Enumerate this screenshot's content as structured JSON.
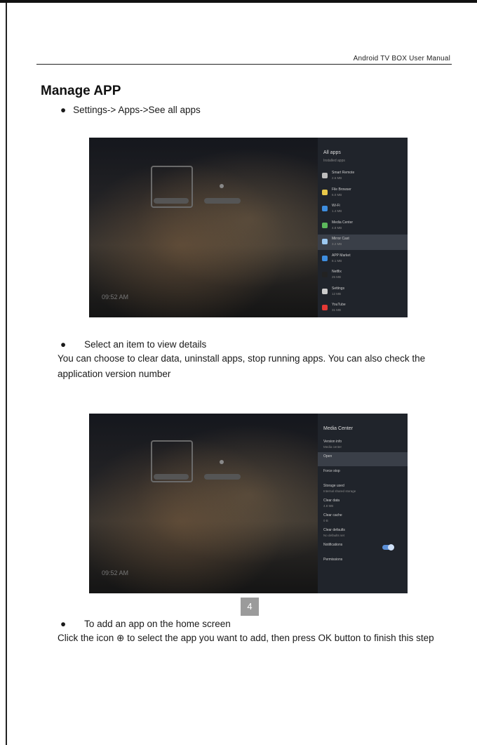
{
  "header": {
    "manual_title": "Android  TV  BOX  User  Manual"
  },
  "section": {
    "title": "Manage APP"
  },
  "step1": {
    "bullet": "●",
    "text": "Settings-> Apps->See all apps"
  },
  "screenshot1": {
    "panel_title": "All apps",
    "panel_subtitle": "Installed apps",
    "clock": "09:52 AM",
    "apps": [
      {
        "name": "Smart Remote",
        "size": "2.6 MB",
        "color": "#bdbdbd"
      },
      {
        "name": "File Browser",
        "size": "6.0 MB",
        "color": "#e8c84a"
      },
      {
        "name": "Wi-Fi",
        "size": "1.4 MB",
        "color": "#3e8ee0"
      },
      {
        "name": "Media Center",
        "size": "4.8 MB",
        "color": "#5cb85c"
      },
      {
        "name": "Mirror Cast",
        "size": "3.2 MB",
        "color": "#9cc8f0"
      },
      {
        "name": "APP Market",
        "size": "8.1 MB",
        "color": "#3e8ee0"
      },
      {
        "name": "Netflix",
        "size": "25 MB",
        "color": "#222222"
      },
      {
        "name": "Settings",
        "size": "12 MB",
        "color": "#cccccc"
      },
      {
        "name": "YouTube",
        "size": "31 MB",
        "color": "#e53935"
      }
    ]
  },
  "step2": {
    "bullet": "●",
    "text": "Select an item to view details",
    "paragraph": "You can choose to clear data, uninstall apps, stop running apps. You can also check the application version number"
  },
  "screenshot2": {
    "panel_title": "Media Center",
    "clock": "09:52 AM",
    "rows": [
      {
        "name": "Version info",
        "sub": "Media center"
      },
      {
        "name": "Open",
        "sub": ""
      },
      {
        "name": "Force stop",
        "sub": ""
      },
      {
        "name": "Storage used",
        "sub": "Internal shared storage"
      },
      {
        "name": "Clear data",
        "sub": "4.8 MB"
      },
      {
        "name": "Clear cache",
        "sub": "0 B"
      },
      {
        "name": "Clear defaults",
        "sub": "No defaults set"
      },
      {
        "name": "Notifications",
        "sub": ""
      },
      {
        "name": "Permissions",
        "sub": ""
      }
    ]
  },
  "step3": {
    "bullet": "●",
    "text": "To add an app on the home screen",
    "paragraph": "Click the icon ⊕  to select the app you want to add, then press OK button to finish this step"
  },
  "footer": {
    "page_number": "4"
  }
}
